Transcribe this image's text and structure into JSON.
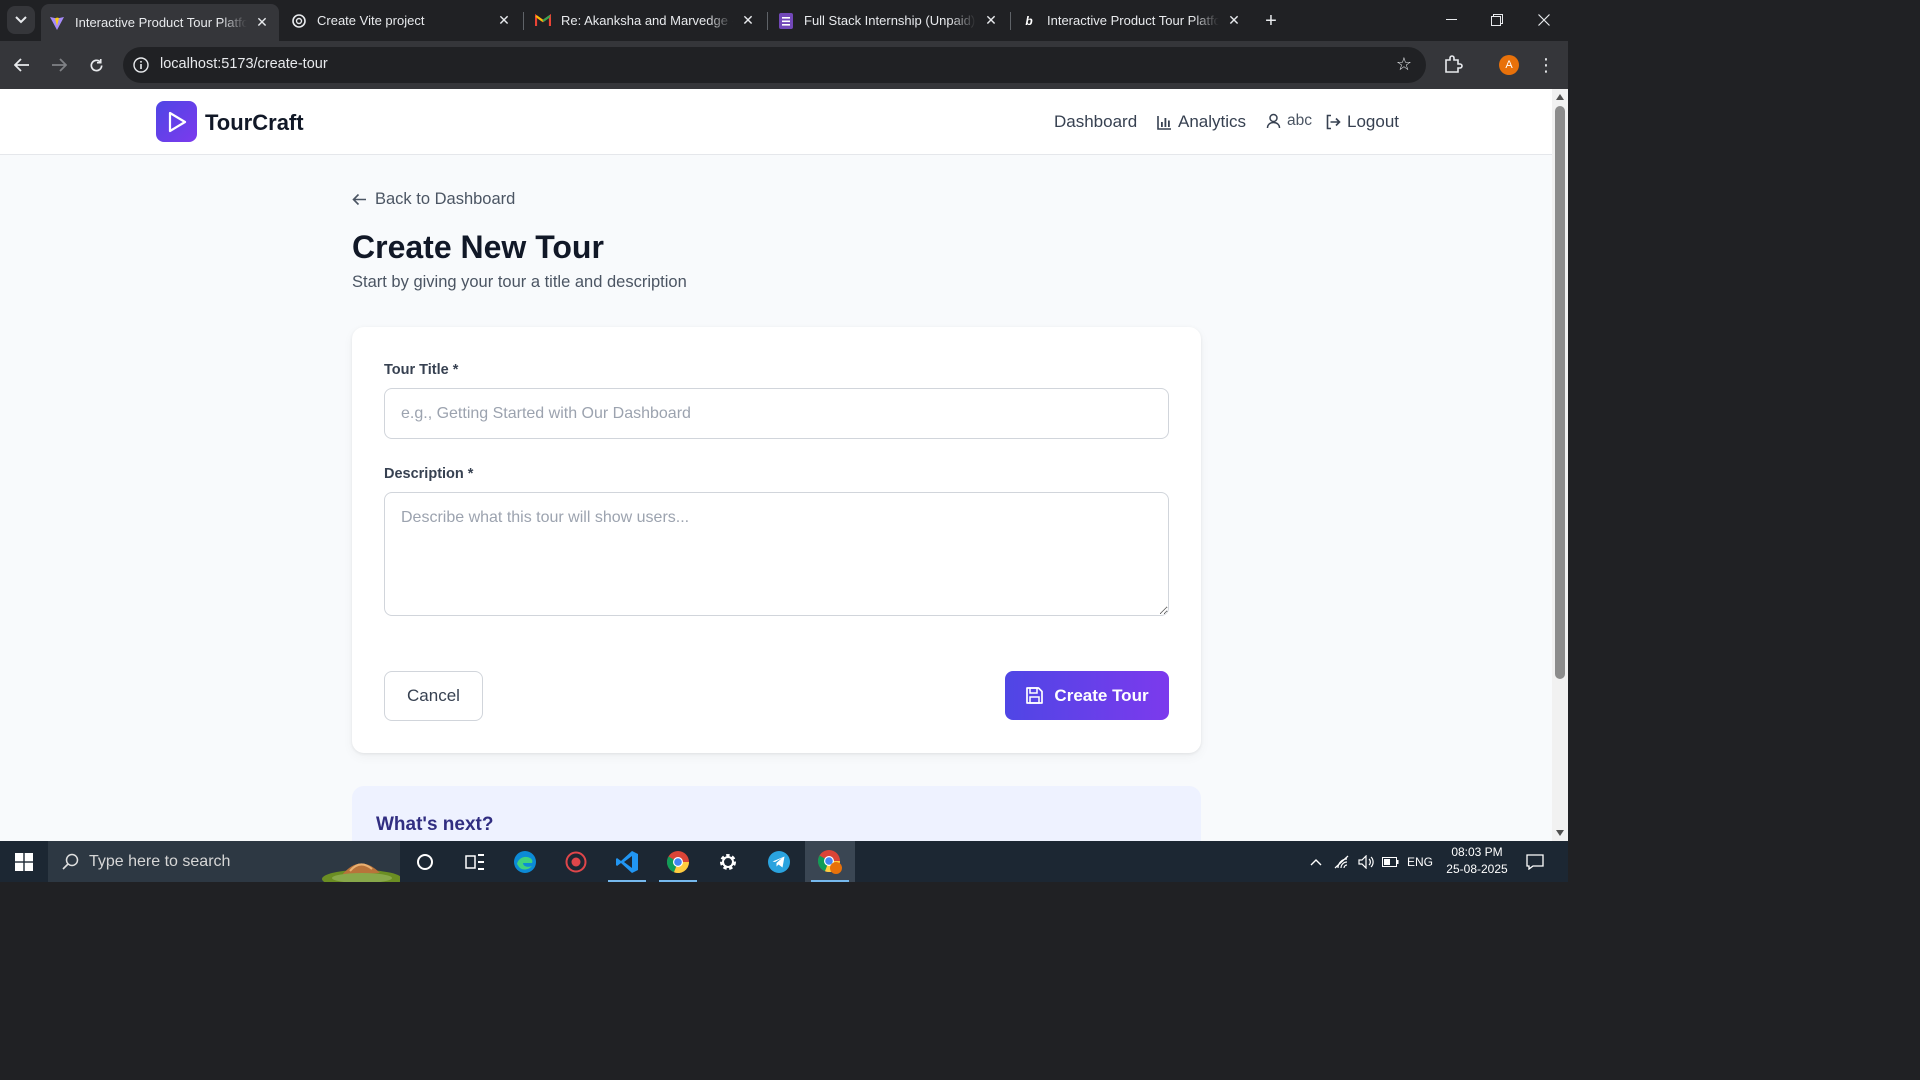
{
  "browser": {
    "tabs": [
      {
        "title": "Interactive Product Tour Platform",
        "icon": "vite-icon",
        "active": true
      },
      {
        "title": "Create Vite project",
        "icon": "openai-icon",
        "active": false
      },
      {
        "title": "Re: Akanksha and Marvedge - re",
        "icon": "gmail-icon",
        "active": false
      },
      {
        "title": "Full Stack Internship (Unpaid)",
        "icon": "forms-icon",
        "active": false
      },
      {
        "title": "Interactive Product Tour Platform",
        "icon": "bolt-icon",
        "active": false
      }
    ],
    "url": "localhost:5173/create-tour",
    "profile_initial": "A"
  },
  "app": {
    "brand": "TourCraft",
    "nav": {
      "dashboard": "Dashboard",
      "analytics": "Analytics",
      "user": "abc",
      "logout": "Logout"
    }
  },
  "page": {
    "back_link": "Back to Dashboard",
    "title": "Create New Tour",
    "subtitle": "Start by giving your tour a title and description"
  },
  "form": {
    "title_label": "Tour Title *",
    "title_value": "",
    "title_placeholder": "e.g., Getting Started with Our Dashboard",
    "description_label": "Description *",
    "description_value": "",
    "description_placeholder": "Describe what this tour will show users...",
    "cancel_label": "Cancel",
    "submit_label": "Create Tour"
  },
  "next_section": {
    "title": "What's next?"
  },
  "taskbar": {
    "search_placeholder": "Type here to search",
    "language": "ENG",
    "time": "08:03 PM",
    "date": "25-08-2025"
  },
  "colors": {
    "accent_start": "#4f46e5",
    "accent_end": "#7c3aed",
    "page_bg": "#f8fafc",
    "next_card_bg": "#eef2ff"
  }
}
